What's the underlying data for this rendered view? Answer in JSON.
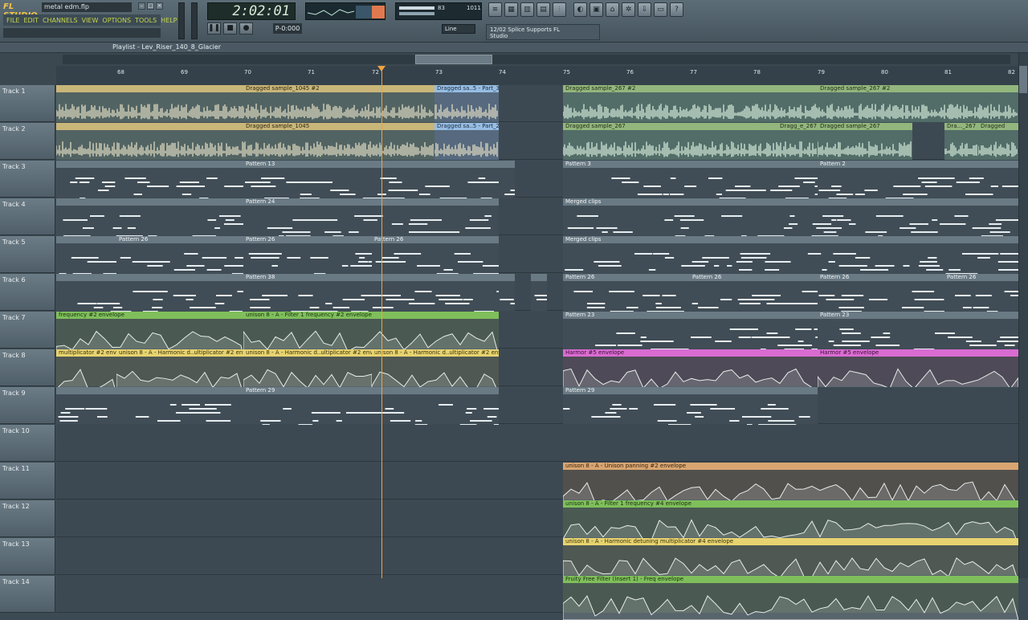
{
  "window": {
    "app_logo": "FL STUDIO",
    "filename": "metal edm.flp",
    "min": "–",
    "max": "□",
    "close": "×"
  },
  "menu": [
    "FILE",
    "EDIT",
    "CHANNELS",
    "VIEW",
    "OPTIONS",
    "TOOLS",
    "HELP"
  ],
  "transport": {
    "time": "2:02:01",
    "pattern_number": "P-0:000",
    "snap": "Line",
    "cpu": "83",
    "poly": "1011"
  },
  "hint": {
    "line1": "12/02 Splice Supports FL",
    "line2": "Studio"
  },
  "playlist": {
    "title": "Playlist - Lev_Riser_140_8_Glacier"
  },
  "bars": [
    "68",
    "69",
    "70",
    "71",
    "72",
    "73",
    "74",
    "75",
    "76",
    "77",
    "78",
    "79",
    "80",
    "81",
    "82"
  ],
  "tracks": [
    {
      "label": "Track 1",
      "clips": [
        {
          "name": "",
          "kind": "tan"
        },
        {
          "name": "Dragged sample_1045 #2",
          "kind": "tan"
        },
        {
          "name": "Dragged sa..5 - Part_3",
          "kind": "audio2"
        },
        {
          "name": "Dragged sample_267 #2",
          "kind": "audio"
        },
        {
          "name": "Dragged sample_267 #2",
          "kind": "audio"
        }
      ]
    },
    {
      "label": "Track 2",
      "clips": [
        {
          "name": "",
          "kind": "tan"
        },
        {
          "name": "Dragged sample_1045",
          "kind": "tan"
        },
        {
          "name": "Dragged sa..5 - Part_2",
          "kind": "audio2"
        },
        {
          "name": "Dragged sample_267",
          "kind": "audio"
        },
        {
          "name": "Dragg_e_267",
          "kind": "audio"
        },
        {
          "name": "Dragged sample_267",
          "kind": "audio"
        },
        {
          "name": "Dra..._267",
          "kind": "audio"
        },
        {
          "name": "Dragged",
          "kind": "audio"
        }
      ]
    },
    {
      "label": "Track 3",
      "clips": [
        {
          "name": "",
          "kind": "pat"
        },
        {
          "name": "Pattern 13",
          "kind": "pat"
        },
        {
          "name": "",
          "kind": "pat"
        },
        {
          "name": "Pattern 3",
          "kind": "pat"
        },
        {
          "name": "Pattern 2",
          "kind": "pat"
        }
      ]
    },
    {
      "label": "Track 4",
      "clips": [
        {
          "name": "",
          "kind": "pat"
        },
        {
          "name": "Pattern 24",
          "kind": "pat"
        },
        {
          "name": "Merged clips",
          "kind": "pat"
        }
      ]
    },
    {
      "label": "Track 5",
      "clips": [
        {
          "name": "",
          "kind": "pat"
        },
        {
          "name": "Pattern 26",
          "kind": "pat"
        },
        {
          "name": "Pattern 26",
          "kind": "pat"
        },
        {
          "name": "Pattern 26",
          "kind": "pat"
        },
        {
          "name": "Merged clips",
          "kind": "pat"
        }
      ]
    },
    {
      "label": "Track 6",
      "clips": [
        {
          "name": "",
          "kind": "pat"
        },
        {
          "name": "Pattern 38",
          "kind": "pat"
        },
        {
          "name": "",
          "kind": "pat"
        },
        {
          "name": "",
          "kind": "pat"
        },
        {
          "name": "Pattern 26",
          "kind": "pat"
        },
        {
          "name": "Pattern 26",
          "kind": "pat"
        },
        {
          "name": "Pattern 26",
          "kind": "pat"
        },
        {
          "name": "Pattern 26",
          "kind": "pat"
        }
      ]
    },
    {
      "label": "Track 7",
      "clips": [
        {
          "name": "frequency #2 envelope",
          "kind": "env-g"
        },
        {
          "name": "unison 8 - A - Filter 1 frequency #2 envelope",
          "kind": "env-g"
        },
        {
          "name": "Pattern 23",
          "kind": "pat"
        },
        {
          "name": "Pattern 23",
          "kind": "pat"
        }
      ]
    },
    {
      "label": "Track 8",
      "clips": [
        {
          "name": "multiplicator #2 envelope",
          "kind": "env-y"
        },
        {
          "name": "unison 8 - A - Harmonic d..ultiplicator #2 envelope",
          "kind": "env-y"
        },
        {
          "name": "unison 8 - A - Harmonic d..ultiplicator #2 envelope",
          "kind": "env-y"
        },
        {
          "name": "unison 8 - A - Harmonic d..ultiplicator #2 envelope",
          "kind": "env-y"
        },
        {
          "name": "Harmor #5 envelope",
          "kind": "env-p"
        },
        {
          "name": "Harmor #5 envelope",
          "kind": "env-p"
        }
      ]
    },
    {
      "label": "Track 9",
      "clips": [
        {
          "name": "",
          "kind": "pat"
        },
        {
          "name": "Pattern 29",
          "kind": "pat"
        },
        {
          "name": "Pattern 29",
          "kind": "pat"
        }
      ]
    },
    {
      "label": "Track 10",
      "clips": []
    },
    {
      "label": "Track 11",
      "clips": [
        {
          "name": "unison 8 - A - Unison panning #2 envelope",
          "kind": "env-o"
        }
      ]
    },
    {
      "label": "Track 12",
      "clips": [
        {
          "name": "unison 8 - A - Filter 1 frequency #4 envelope",
          "kind": "env-g"
        }
      ]
    },
    {
      "label": "Track 13",
      "clips": [
        {
          "name": "unison 8 - A - Harmonic detuning multiplicator #4 envelope",
          "kind": "env-y"
        }
      ]
    },
    {
      "label": "Track 14",
      "clips": [
        {
          "name": "Fruity Free Filter (Insert 1) - Freq envelope",
          "kind": "env-g"
        }
      ]
    }
  ],
  "colors": {
    "cursor": "#f0a340",
    "audio": "#93b67d",
    "pattern": "#6a7a84",
    "env_green": "#7fbf5b",
    "env_yellow": "#e7d36f",
    "env_pink": "#d96cd1",
    "env_orange": "#d8a571"
  }
}
